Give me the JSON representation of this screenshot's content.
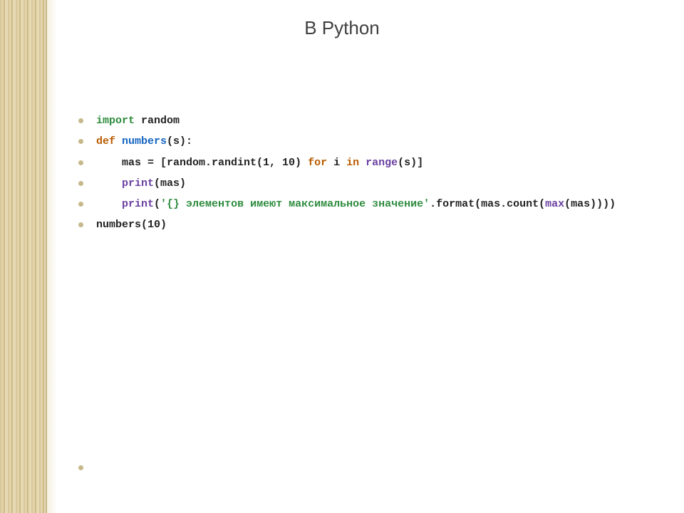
{
  "title": "В Python",
  "code": {
    "l1": {
      "kw_import": "import",
      "rest": " random"
    },
    "l2": {
      "kw_def": "def",
      "fn": " numbers",
      "rest": "(s):"
    },
    "l3": {
      "indent": "    ",
      "pre": "mas = [random.randint(1, 10) ",
      "kw_for": "for",
      "mid": " i ",
      "kw_in": "in",
      "sp": " ",
      "fn_range": "range",
      "post": "(s)]"
    },
    "l4": {
      "indent": "    ",
      "fn_print": "print",
      "rest": "(mas)"
    },
    "l5": {
      "indent": "    ",
      "fn_print": "print",
      "open": "(",
      "str": "'{} элементов имеют максимальное значение'",
      "mid": ".format(mas.count(",
      "fn_max": "max",
      "close": "(mas))))"
    },
    "l6": {
      "text": "numbers(10)"
    }
  }
}
